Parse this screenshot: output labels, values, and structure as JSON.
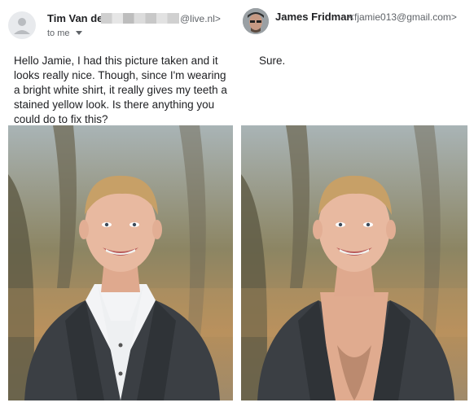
{
  "left_email": {
    "sender_name": "Tim Van der",
    "sender_email_suffix": "@live.nl>",
    "recipient_line": "to me",
    "message": "Hello Jamie, I had this picture taken and it looks really nice. Though, since I'm wearing a bright white shirt, it really gives my teeth a stained yellow look. Is there anything you could do to fix this?",
    "photo_icon": "man-in-white-shirt-photo"
  },
  "right_email": {
    "sender_name": "James Fridman",
    "sender_email": "<fjamie013@gmail.com>",
    "message": "Sure.",
    "photo_icon": "man-with-shirt-removed-photo"
  },
  "colors": {
    "jacket": "#3b3f44",
    "shirt": "#f3f4f6",
    "skin": "#e8b9a0",
    "hair": "#c7a067",
    "background_trees": "#7a6a4a"
  }
}
